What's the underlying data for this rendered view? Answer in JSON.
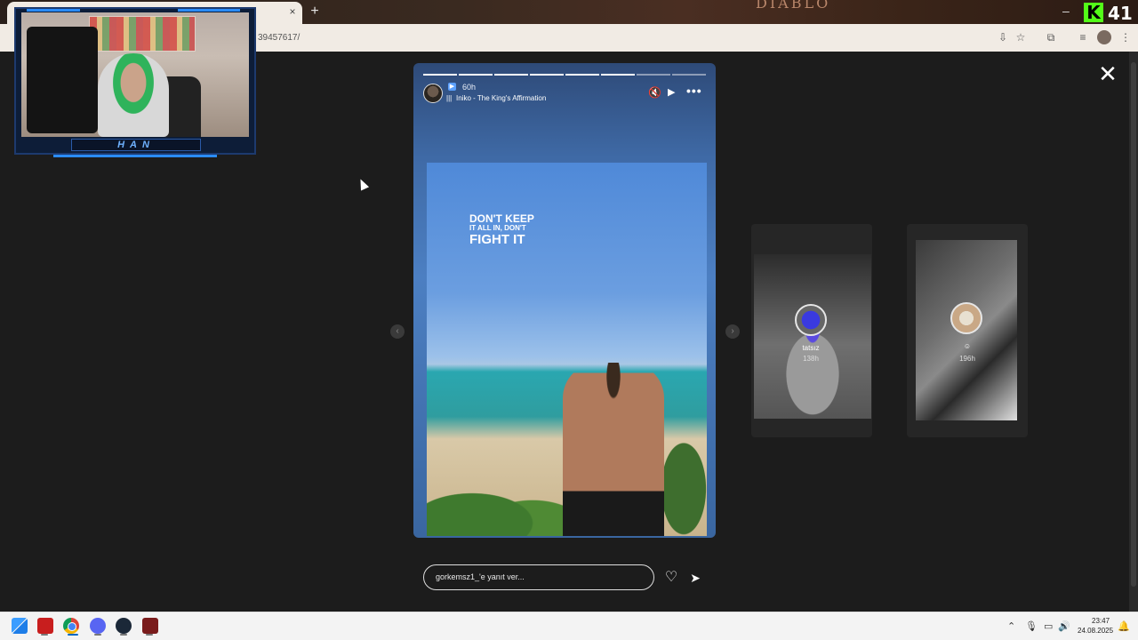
{
  "browser": {
    "url": "39457617/",
    "tab_close": "×",
    "new_tab": "+",
    "banner_text": "DIABLO",
    "minimize": "–",
    "kick_logo": "K",
    "kick_viewer_count": "41"
  },
  "overlay": {
    "webcam_name": "HAN"
  },
  "story": {
    "time": "60h",
    "music_label": "Iniko - The King's Affirmation",
    "caption_line1": "DON'T KEEP",
    "caption_line2": "IT ALL IN, DON'T",
    "caption_line3": "FIGHT IT",
    "progress_segments": 8,
    "progress_done": 6
  },
  "previews": [
    {
      "name": "tatsız",
      "time": "138h"
    },
    {
      "name": "",
      "time": "196h"
    }
  ],
  "reply": {
    "placeholder": "gorkemsz1_'e yanıt ver..."
  },
  "icons": {
    "close": "✕",
    "mute": "🔇",
    "play": "▶",
    "more": "•••",
    "prev": "‹",
    "next": "›",
    "like": "♡",
    "share": "➤",
    "music": "|||",
    "tray_chevron": "⌃",
    "tray_mic": "🎙",
    "tray_net": "▭",
    "tray_vol": "🔊",
    "tray_notif": "🔔"
  },
  "taskbar": {
    "time": "23:47",
    "date": "24.08.2025"
  }
}
